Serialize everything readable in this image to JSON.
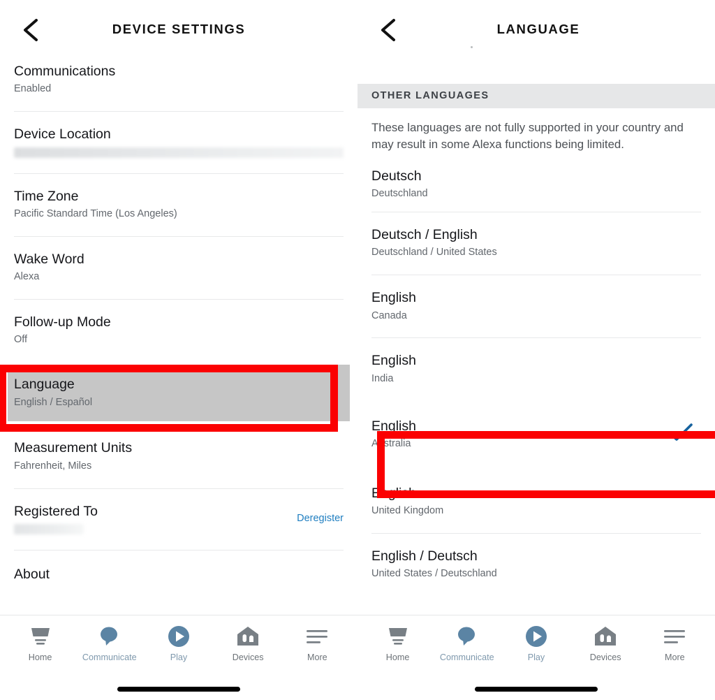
{
  "colors": {
    "highlight_box": "#fb0102",
    "selected_row_bg": "#c6c6c6",
    "link": "#1f7ec0",
    "checkmark": "#16629e",
    "section_header_bg": "#e6e7e8",
    "tab_accent": "#5b84a4",
    "tab_grey": "#6d7378"
  },
  "left_panel": {
    "header": {
      "back_icon": "chevron-left-icon",
      "title": "DEVICE SETTINGS"
    },
    "rows": [
      {
        "title": "Communications",
        "sub": "Enabled",
        "redacted": false,
        "action": "",
        "highlighted": false
      },
      {
        "title": "Device Location",
        "sub": "",
        "redacted": true,
        "redacted_width": "full",
        "action": "",
        "highlighted": false
      },
      {
        "title": "Time Zone",
        "sub": "Pacific Standard Time (Los Angeles)",
        "redacted": false,
        "action": "",
        "highlighted": false
      },
      {
        "title": "Wake Word",
        "sub": "Alexa",
        "redacted": false,
        "action": "",
        "highlighted": false
      },
      {
        "title": "Follow-up Mode",
        "sub": "Off",
        "redacted": false,
        "action": "",
        "highlighted": false
      },
      {
        "title": "Language",
        "sub": "English / Español",
        "redacted": false,
        "action": "",
        "highlighted": true
      },
      {
        "title": "Measurement Units",
        "sub": "Fahrenheit, Miles",
        "redacted": false,
        "action": "",
        "highlighted": false
      },
      {
        "title": "Registered To",
        "sub": "",
        "redacted": true,
        "redacted_width": "short",
        "action": "Deregister",
        "highlighted": false
      },
      {
        "title": "About",
        "sub": "",
        "redacted": false,
        "action": "",
        "highlighted": false
      }
    ]
  },
  "right_panel": {
    "header": {
      "back_icon": "chevron-left-icon",
      "title": "LANGUAGE"
    },
    "section": {
      "label": "OTHER LANGUAGES",
      "note": "These languages are not fully supported in your country and may result in some Alexa functions being limited."
    },
    "rows": [
      {
        "title": "Deutsch",
        "sub": "Deutschland",
        "selected": false,
        "highlighted": false
      },
      {
        "title": "Deutsch / English",
        "sub": "Deutschland / United States",
        "selected": false,
        "highlighted": false
      },
      {
        "title": "English",
        "sub": "Canada",
        "selected": false,
        "highlighted": false
      },
      {
        "title": "English",
        "sub": "India",
        "selected": false,
        "highlighted": false
      },
      {
        "title": "English",
        "sub": "Australia",
        "selected": true,
        "highlighted": true
      },
      {
        "title": "English",
        "sub": "United Kingdom",
        "selected": false,
        "highlighted": false
      },
      {
        "title": "English / Deutsch",
        "sub": "United States / Deutschland",
        "selected": false,
        "highlighted": false
      }
    ]
  },
  "tabbar": {
    "items": [
      {
        "label": "Home",
        "icon": "home-icon",
        "active": false
      },
      {
        "label": "Communicate",
        "icon": "speech-bubble-icon",
        "active": true
      },
      {
        "label": "Play",
        "icon": "play-circle-icon",
        "active": true
      },
      {
        "label": "Devices",
        "icon": "devices-house-icon",
        "active": false
      },
      {
        "label": "More",
        "icon": "hamburger-menu-icon",
        "active": false
      }
    ]
  }
}
